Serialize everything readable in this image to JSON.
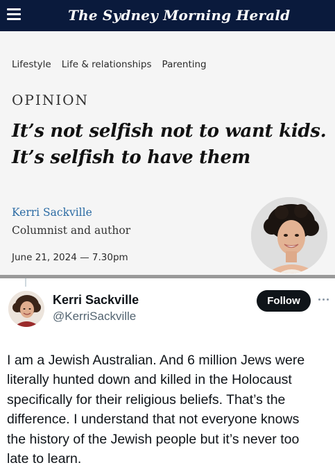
{
  "site": {
    "logo_text": "The Sydney Morning Herald",
    "menu_icon": "hamburger-menu-icon"
  },
  "breadcrumbs": [
    "Lifestyle",
    "Life & relationships",
    "Parenting"
  ],
  "article": {
    "kicker": "OPINION",
    "headline_lines": [
      "It’s not selfish not to want kids.",
      "It’s selfish to have them"
    ],
    "author_name": "Kerri Sackville",
    "author_role": "Columnist and author",
    "date": "June 21, 2024 — 7.30pm"
  },
  "tweet": {
    "display_name": "Kerri Sackville",
    "handle": "@KerriSackville",
    "follow_label": "Follow",
    "more_icon": "more-options-icon",
    "text_lines": [
      "I am a Jewish Australian. And 6 million Jews were",
      "literally hunted down and killed in the Holocaust",
      "specifically for their religious beliefs. That’s the",
      "difference. I understand that not everyone knows",
      "the history of the Jewish people but it’s never too",
      "late to learn."
    ]
  },
  "colors": {
    "masthead": "#0a1a3c",
    "author_link": "#2a6aa3",
    "follow_button": "#0f1419",
    "handle_gray": "#536471"
  }
}
